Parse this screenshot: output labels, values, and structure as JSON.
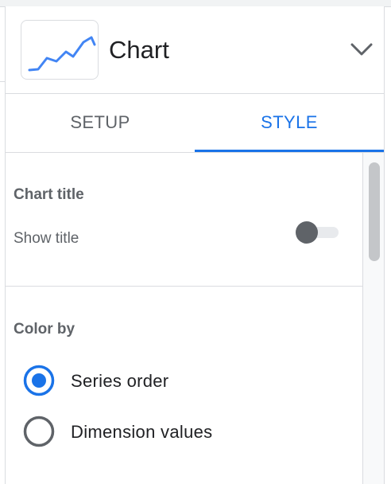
{
  "header": {
    "chart_type_label": "Chart",
    "chart_icon": "line-chart-icon",
    "dropdown_icon": "chevron-down-icon"
  },
  "tabs": [
    {
      "label": "SETUP",
      "active": false
    },
    {
      "label": "STYLE",
      "active": true
    }
  ],
  "sections": {
    "chart_title": {
      "heading": "Chart title",
      "show_title_label": "Show title",
      "show_title_on": false
    },
    "color_by": {
      "heading": "Color by",
      "options": [
        {
          "label": "Series order",
          "selected": true
        },
        {
          "label": "Dimension values",
          "selected": false
        }
      ]
    }
  },
  "colors": {
    "accent": "#1a73e8",
    "text_secondary": "#5f6368",
    "border": "#dadce0"
  }
}
